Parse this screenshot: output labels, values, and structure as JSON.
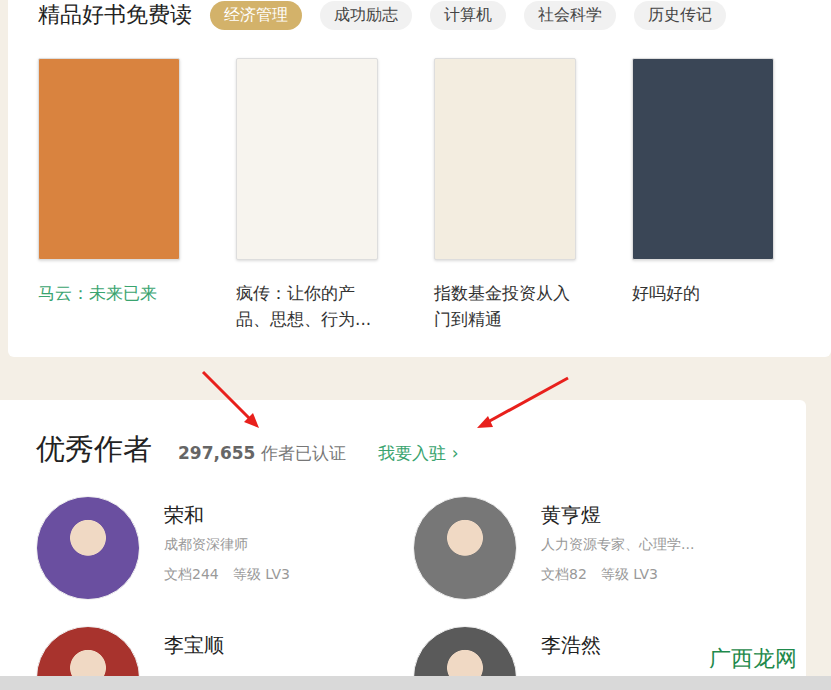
{
  "books_section": {
    "title": "精品好书免费读",
    "tabs": [
      {
        "label": "经济管理",
        "selected": true
      },
      {
        "label": "成功励志",
        "selected": false
      },
      {
        "label": "计算机",
        "selected": false
      },
      {
        "label": "社会科学",
        "selected": false
      },
      {
        "label": "历史传记",
        "selected": false
      }
    ],
    "books": [
      {
        "title": "马云：未来已来",
        "highlighted": true,
        "color": "#d9833f"
      },
      {
        "title": "疯传：让你的产品、思想、行为...",
        "highlighted": false,
        "color": "#f7f4ee"
      },
      {
        "title": "指数基金投资从入门到精通",
        "highlighted": false,
        "color": "#f3ede0"
      },
      {
        "title": "好吗好的",
        "highlighted": false,
        "color": "#3a4656"
      }
    ]
  },
  "authors_section": {
    "title": "优秀作者",
    "count": "297,655",
    "count_label": "作者已认证",
    "join_link": "我要入驻 ›",
    "authors": [
      {
        "name": "荣和",
        "desc": "成都资深律师",
        "docs": "文档244",
        "level": "等级 LV3",
        "color": "#6a4fa0"
      },
      {
        "name": "黄亨煜",
        "desc": "人力资源专家、心理学...",
        "docs": "文档82",
        "level": "等级 LV3",
        "color": "#777777"
      },
      {
        "name": "李宝顺",
        "desc": "",
        "docs": "",
        "level": "",
        "color": "#a8332d"
      },
      {
        "name": "李浩然",
        "desc": "",
        "docs": "",
        "level": "",
        "color": "#5a5a5a"
      }
    ]
  },
  "watermark": "广西龙网"
}
